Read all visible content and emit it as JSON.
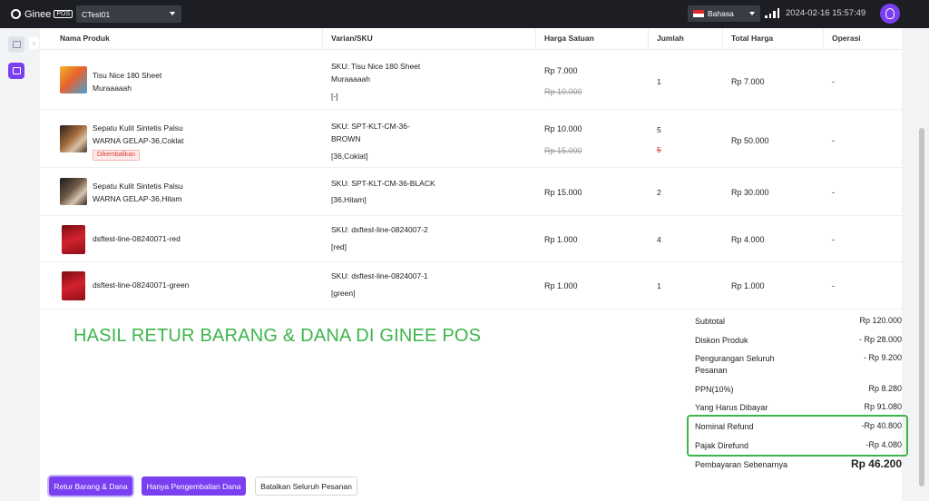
{
  "topbar": {
    "brand": "Ginee",
    "brand_badge": "POS",
    "store": "CTest01",
    "language": "Bahasa",
    "datetime": "2024-02-16 15:57:49"
  },
  "columns": [
    "Nama Produk",
    "Varian/SKU",
    "Harga Satuan",
    "Jumlah",
    "Total Harga",
    "Operasi"
  ],
  "rows": [
    {
      "name": [
        "Tisu Nice 180 Sheet",
        "Muraaaaah"
      ],
      "badge": "",
      "sku": [
        "SKU: Tisu Nice 180 Sheet",
        "Muraaaaah"
      ],
      "variant": "[-]",
      "price": "Rp 7.000",
      "price_old": "Rp 10.000",
      "qty": "1",
      "qty_old": "",
      "total": "Rp 7.000",
      "op": "-"
    },
    {
      "name": [
        "Sepatu Kulit Sintetis Palsu",
        "WARNA GELAP-36,Coklat"
      ],
      "badge": "Dikembalikan",
      "sku": [
        "SKU: SPT-KLT-CM-36-",
        "BROWN"
      ],
      "variant": "[36,Coklat]",
      "price": "Rp 10.000",
      "price_old": "Rp 15.000",
      "qty": "5",
      "qty_old": "5",
      "total": "Rp 50.000",
      "op": "-"
    },
    {
      "name": [
        "Sepatu Kulit Sintetis Palsu",
        "WARNA GELAP-36,Hitam"
      ],
      "badge": "",
      "sku": [
        "SKU: SPT-KLT-CM-36-BLACK"
      ],
      "variant": "[36,Hitam]",
      "price": "Rp 15.000",
      "price_old": "",
      "qty": "2",
      "qty_old": "",
      "total": "Rp 30.000",
      "op": "-"
    },
    {
      "name": [
        "dsftest-line-08240071-red"
      ],
      "badge": "",
      "sku": [
        "SKU: dsftest-line-0824007-2"
      ],
      "variant": "[red]",
      "price": "Rp 1.000",
      "price_old": "",
      "qty": "4",
      "qty_old": "",
      "total": "Rp 4.000",
      "op": "-"
    },
    {
      "name": [
        "dsftest-line-08240071-green"
      ],
      "badge": "",
      "sku": [
        "SKU: dsftest-line-0824007-1"
      ],
      "variant": "[green]",
      "price": "Rp 1.000",
      "price_old": "",
      "qty": "1",
      "qty_old": "",
      "total": "Rp 1.000",
      "op": "-"
    }
  ],
  "headline": "HASIL RETUR BARANG & DANA DI GINEE POS",
  "summary": {
    "subtotal_label": "Subtotal",
    "subtotal": "Rp 120.000",
    "discount_label": "Diskon Produk",
    "discount": "- Rp 28.000",
    "order_reduction_label": "Pengurangan Seluruh Pesanan",
    "order_reduction": "- Rp 9.200",
    "ppn_label": "PPN(10%)",
    "ppn": "Rp 8.280",
    "payable_label": "Yang Harus Dibayar",
    "payable": "Rp 91.080",
    "refund_label": "Nominal Refund",
    "refund": "-Rp 40.800",
    "tax_refund_label": "Pajak Direfund",
    "tax_refund": "-Rp 4.080",
    "actual_label": "Pembayaran Sebenarnya",
    "actual": "Rp 46.200"
  },
  "buttons": {
    "return_goods_funds": "Retur Barang & Dana",
    "refund_only": "Hanya Pengembalian Dana",
    "cancel_order": "Batalkan Seluruh Pesanan"
  },
  "colors": {
    "accent": "#7b3ff2",
    "highlight": "#3cb54a",
    "danger": "#e0352b",
    "topbar": "#1d1e24"
  }
}
